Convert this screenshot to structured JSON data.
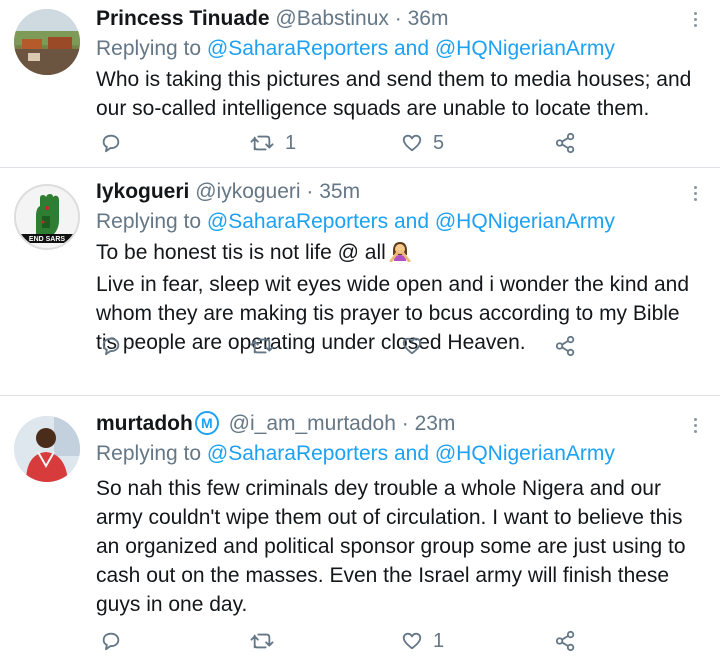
{
  "tweets": [
    {
      "name": "Princess Tinuade",
      "handle": "@Babstinux",
      "time": "· 36m",
      "replying_prefix": "Replying to",
      "reply_link": "@SaharaReporters and @HQNigerianArmy",
      "lines": [
        "Who is taking this pictures and send them to media houses; and",
        "our so-called intelligence squads are unable to locate them."
      ],
      "retweets": "1",
      "likes": "5"
    },
    {
      "name": "Iykogueri",
      "handle": "@iykogueri",
      "time": "· 35m",
      "replying_prefix": "Replying to",
      "reply_link": "@SaharaReporters and @HQNigerianArmy",
      "lines": [
        "To be honest tis is not life @ all",
        "Live in fear, sleep wit eyes wide open and i wonder the kind and",
        "whom they are making tis prayer to bcus according to my Bible",
        "tis people are operating under closed Heaven."
      ],
      "avatar_text": "END SARS",
      "retweets": "",
      "likes": ""
    },
    {
      "name": "murtadoh",
      "badge": "M",
      "handle": "@i_am_murtadoh",
      "time": "· 23m",
      "replying_prefix": "Replying to",
      "reply_link": "@SaharaReporters and @HQNigerianArmy",
      "lines": [
        "So nah this few criminals dey trouble a whole Nigera and our",
        "army couldn't wipe them out of circulation. I want to believe this",
        "an organized and political sponsor group some are just using to",
        "cash out on the masses. Even the Israel army will finish these",
        "guys in one day."
      ],
      "retweets": "",
      "likes": "1"
    }
  ],
  "icons": {
    "reply": "reply-icon",
    "retweet": "retweet-icon",
    "like": "like-icon",
    "share": "share-icon",
    "more": "more-options-icon",
    "emoji": "woman-gesturing-no-emoji"
  },
  "colors": {
    "link": "#1da1f2",
    "secondary_text": "#657786",
    "primary_text": "#14171a",
    "divider": "#dfe3e7"
  }
}
